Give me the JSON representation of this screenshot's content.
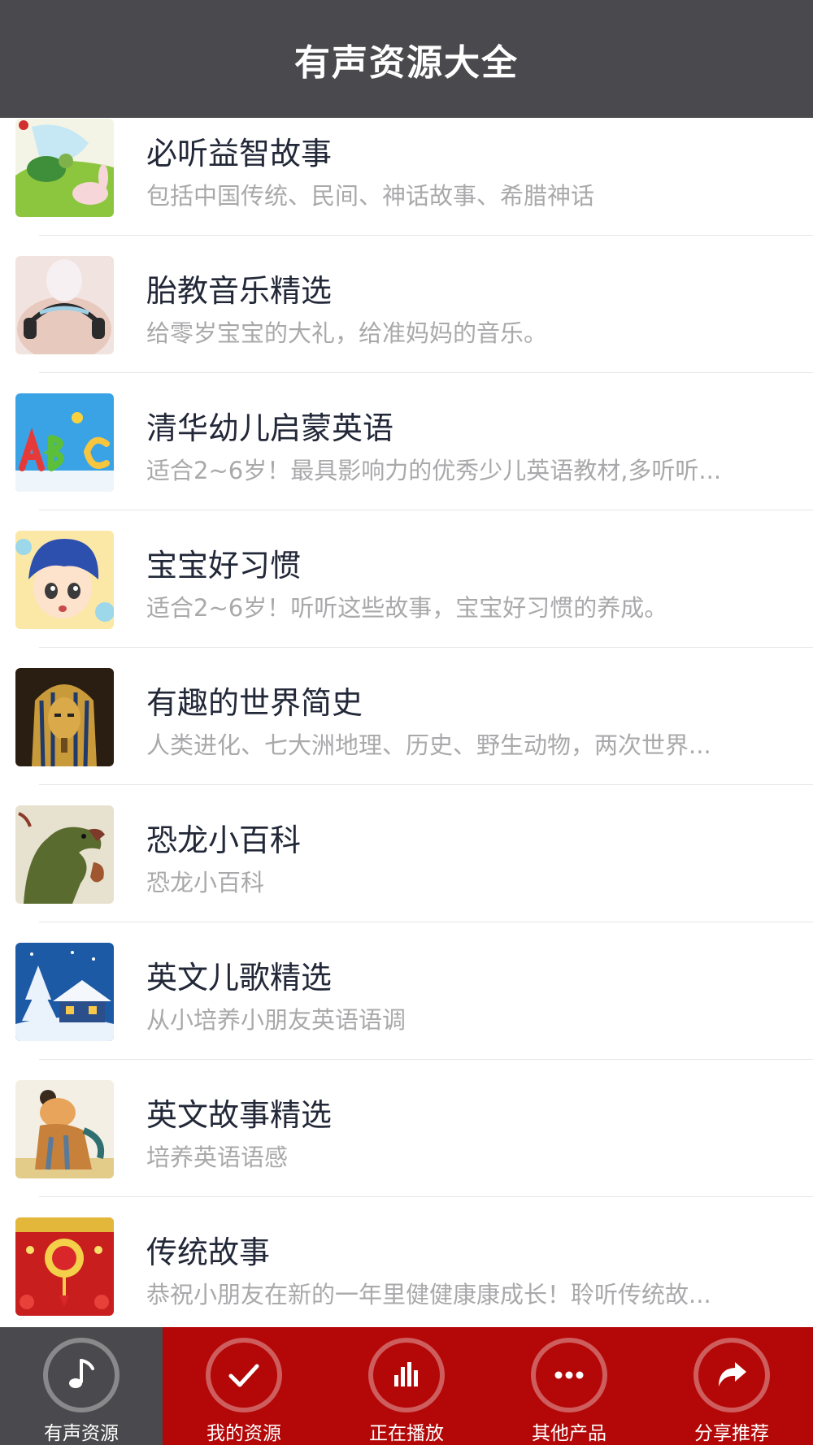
{
  "header": {
    "title": "有声资源大全"
  },
  "items": [
    {
      "title": "必听益智故事",
      "subtitle": "包括中国传统、民间、神话故事、希腊神话",
      "thumb_icon": "turtle-rabbit-thumbnail"
    },
    {
      "title": "胎教音乐精选",
      "subtitle": "给零岁宝宝的大礼，给准妈妈的音乐。",
      "thumb_icon": "pregnant-belly-headphones-thumbnail"
    },
    {
      "title": "清华幼儿启蒙英语",
      "subtitle": "适合2~6岁！最具影响力的优秀少儿英语教材,多听听...",
      "thumb_icon": "abc-letters-thumbnail"
    },
    {
      "title": "宝宝好习惯",
      "subtitle": "适合2~6岁！听听这些故事，宝宝好习惯的养成。",
      "thumb_icon": "cartoon-boy-thumbnail"
    },
    {
      "title": "有趣的世界简史",
      "subtitle": "人类进化、七大洲地理、历史、野生动物，两次世界...",
      "thumb_icon": "pharaoh-mask-thumbnail"
    },
    {
      "title": "恐龙小百科",
      "subtitle": "恐龙小百科",
      "thumb_icon": "dinosaur-thumbnail"
    },
    {
      "title": "英文儿歌精选",
      "subtitle": "从小培养小朋友英语语调",
      "thumb_icon": "snowy-house-thumbnail"
    },
    {
      "title": "英文故事精选",
      "subtitle": "培养英语语感",
      "thumb_icon": "cartoon-mouse-thumbnail"
    },
    {
      "title": "传统故事",
      "subtitle": "恭祝小朋友在新的一年里健健康康成长！聆听传统故...",
      "thumb_icon": "chinese-new-year-thumbnail"
    }
  ],
  "tabs": [
    {
      "label": "有声资源",
      "icon": "music-note-icon",
      "active": true
    },
    {
      "label": "我的资源",
      "icon": "checkmark-icon",
      "active": false
    },
    {
      "label": "正在播放",
      "icon": "bar-chart-icon",
      "active": false
    },
    {
      "label": "其他产品",
      "icon": "more-dots-icon",
      "active": false
    },
    {
      "label": "分享推荐",
      "icon": "share-arrow-icon",
      "active": false
    }
  ],
  "colors": {
    "header_bg": "#4a494d",
    "tabbar_bg": "#b40707",
    "tab_active_bg": "#4a494d",
    "title_text": "#222838",
    "subtitle_text": "#a9a9ab"
  }
}
